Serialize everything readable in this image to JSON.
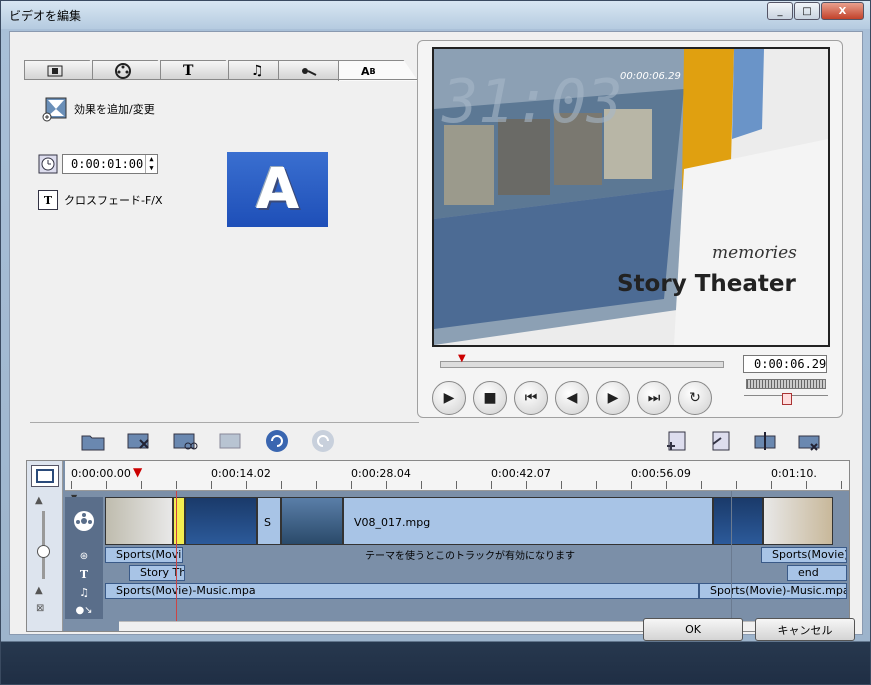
{
  "window": {
    "title": "ビデオを編集",
    "minimize": "_",
    "maximize": "□",
    "close": "X"
  },
  "tabs": [
    "movie",
    "film",
    "title",
    "music",
    "effect",
    "transition"
  ],
  "effect": {
    "add_label": "効果を追加/変更"
  },
  "duration": {
    "value": "0:00:01:00"
  },
  "transition": {
    "label": "クロスフェード-F/X",
    "preview_letter": "A"
  },
  "player": {
    "overlay_small": "00:00:06.29",
    "overlay_big": "31:03",
    "subtitle": "memories",
    "title": "Story Theater",
    "time": "0:00:06.29"
  },
  "toolbar": [
    "open",
    "delete",
    "cut",
    "insert",
    "undo",
    "redo"
  ],
  "toolbar_right": [
    "add",
    "export",
    "split",
    "join"
  ],
  "timeline": {
    "ruler": [
      "0:00:00.00",
      "0:00:14.02",
      "0:00:28.04",
      "0:00:42.07",
      "0:00:56.09",
      "0:01:10."
    ],
    "video_clip": "V08_017.mpg",
    "video_small": "S",
    "overlay_left": "Sports(Movie)-",
    "overlay_right": "Sports(Movie)-",
    "overlay_message": "テーマを使うとこのトラックが有効になります",
    "title_left": "Story The",
    "title_right": "end",
    "music_left": "Sports(Movie)-Music.mpa",
    "music_right": "Sports(Movie)-Music.mpa"
  },
  "buttons": {
    "ok": "OK",
    "cancel": "キャンセル"
  }
}
